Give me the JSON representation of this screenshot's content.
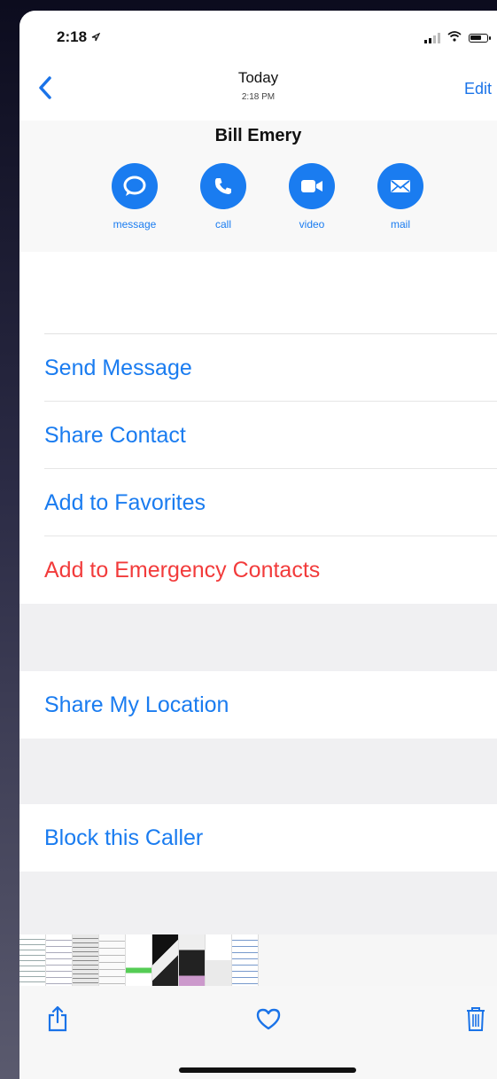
{
  "status_bar": {
    "time": "2:18"
  },
  "nav": {
    "title": "Today",
    "subtitle": "2:18 PM",
    "edit_label": "Edit"
  },
  "contact": {
    "name": "Bill Emery",
    "actions": [
      {
        "label": "message",
        "icon": "message-bubble-icon"
      },
      {
        "label": "call",
        "icon": "phone-icon"
      },
      {
        "label": "video",
        "icon": "video-camera-icon"
      },
      {
        "label": "mail",
        "icon": "envelope-icon"
      }
    ]
  },
  "options": {
    "send_message": "Send Message",
    "share_contact": "Share Contact",
    "add_favorites": "Add to Favorites",
    "add_emergency": "Add to Emergency Contacts",
    "share_location": "Share My Location",
    "block_caller": "Block this Caller"
  },
  "colors": {
    "accent": "#1a7cf0",
    "danger": "#f23b3b"
  },
  "toolbar": {
    "icons": [
      "share-icon",
      "heart-icon",
      "trash-icon"
    ]
  }
}
